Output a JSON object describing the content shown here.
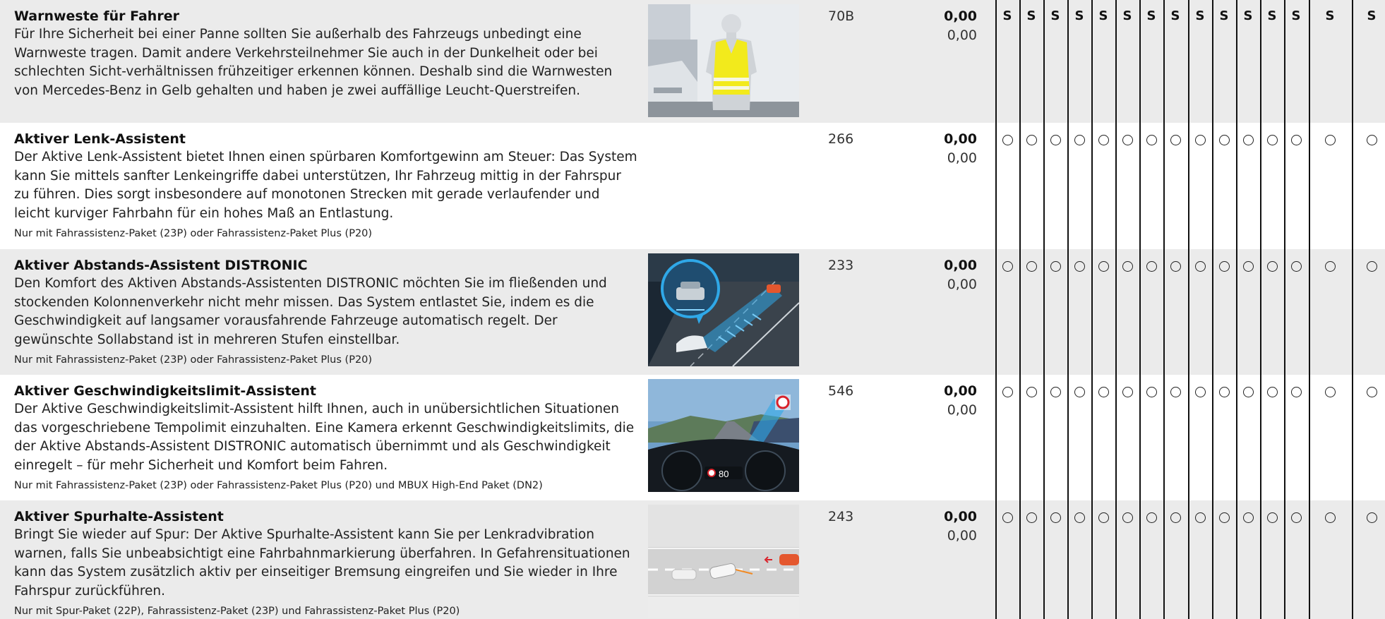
{
  "rows": [
    {
      "title": "Warnweste für Fahrer",
      "description": "Für Ihre Sicherheit bei einer Panne sollten Sie außerhalb des Fahrzeugs unbedingt eine Warnweste tragen. Damit andere Verkehrsteilnehmer Sie auch in der Dunkelheit oder bei schlechten Sicht-verhältnissen frühzeitiger erkennen können. Deshalb sind die Warnwesten von Mercedes-Benz in Gelb gehalten und haben je zwei auffällige Leucht-Querstreifen.",
      "note": "",
      "code": "70B",
      "price_bold": "0,00",
      "price": "0,00",
      "image": "warning-vest-image",
      "availability": [
        "S",
        "S",
        "S",
        "S",
        "S",
        "S",
        "S",
        "S",
        "S",
        "S",
        "S",
        "S",
        "S",
        "S",
        "S"
      ]
    },
    {
      "title": "Aktiver Lenk-Assistent",
      "description": "Der Aktive Lenk-Assistent bietet Ihnen einen spürbaren Komfortgewinn am Steuer: Das System kann Sie mittels sanfter Lenkeingriffe dabei unterstützen, Ihr Fahrzeug mittig in der Fahrspur zu führen. Dies sorgt insbesondere auf monotonen Strecken mit gerade verlaufender und leicht kurviger Fahrbahn für ein hohes Maß an Entlastung.",
      "note": "Nur mit Fahrassistenz-Paket (23P) oder Fahrassistenz-Paket Plus (P20)",
      "code": "266",
      "price_bold": "0,00",
      "price": "0,00",
      "image": "",
      "availability": [
        "O",
        "O",
        "O",
        "O",
        "O",
        "O",
        "O",
        "O",
        "O",
        "O",
        "O",
        "O",
        "O",
        "O",
        "O"
      ]
    },
    {
      "title": "Aktiver Abstands-Assistent DISTRONIC",
      "description": "Den Komfort des Aktiven Abstands-Assistenten DISTRONIC möchten Sie im fließenden und stockenden Kolonnenverkehr nicht mehr missen. Das System entlastet Sie, indem es die Geschwindigkeit auf langsamer vorausfahrende Fahrzeuge automatisch regelt. Der gewünschte Sollabstand ist in mehreren Stufen einstellbar.",
      "note": "Nur mit Fahrassistenz-Paket (23P) oder Fahrassistenz-Paket Plus (P20)",
      "code": "233",
      "price_bold": "0,00",
      "price": "0,00",
      "image": "distronic-image",
      "availability": [
        "O",
        "O",
        "O",
        "O",
        "O",
        "O",
        "O",
        "O",
        "O",
        "O",
        "O",
        "O",
        "O",
        "O",
        "O"
      ]
    },
    {
      "title": "Aktiver Geschwindigkeitslimit-Assistent",
      "description": "Der Aktive Geschwindigkeitslimit-Assistent hilft Ihnen, auch in unübersichtlichen Situationen das vorgeschriebene Tempolimit einzuhalten. Eine Kamera erkennt Geschwindigkeitslimits, die der Aktive Abstands-Assistent DISTRONIC automatisch übernimmt und als Geschwindigkeit einregelt – für mehr Sicherheit und Komfort beim Fahren.",
      "note": "Nur mit Fahrassistenz-Paket (23P) oder Fahrassistenz-Paket Plus (P20) und MBUX High-End Paket (DN2)",
      "code": "546",
      "price_bold": "0,00",
      "price": "0,00",
      "image": "speed-limit-image",
      "image_text": "80",
      "availability": [
        "O",
        "O",
        "O",
        "O",
        "O",
        "O",
        "O",
        "O",
        "O",
        "O",
        "O",
        "O",
        "O",
        "O",
        "O"
      ]
    },
    {
      "title": "Aktiver Spurhalte-Assistent",
      "description": "Bringt Sie wieder auf Spur: Der Aktive Spurhalte-Assistent kann Sie per Lenkradvibration warnen, falls Sie unbeabsichtigt eine Fahrbahnmarkierung überfahren. In Gefahrensituationen kann das System zusätzlich aktiv per einseitiger Bremsung eingreifen und Sie wieder in Ihre Fahrspur zurückführen.",
      "note": "Nur mit Spur-Paket (22P), Fahrassistenz-Paket (23P) und Fahrassistenz-Paket Plus (P20)",
      "code": "243",
      "price_bold": "0,00",
      "price": "0,00",
      "image": "lane-keeping-image",
      "availability": [
        "O",
        "O",
        "O",
        "O",
        "O",
        "O",
        "O",
        "O",
        "O",
        "O",
        "O",
        "O",
        "O",
        "O",
        "O"
      ]
    }
  ],
  "colors": {
    "row_shade": "#ebebeb",
    "vest_yellow": "#f2ea1c",
    "sensor_blue": "#2fa8e8",
    "line": "#111111"
  }
}
